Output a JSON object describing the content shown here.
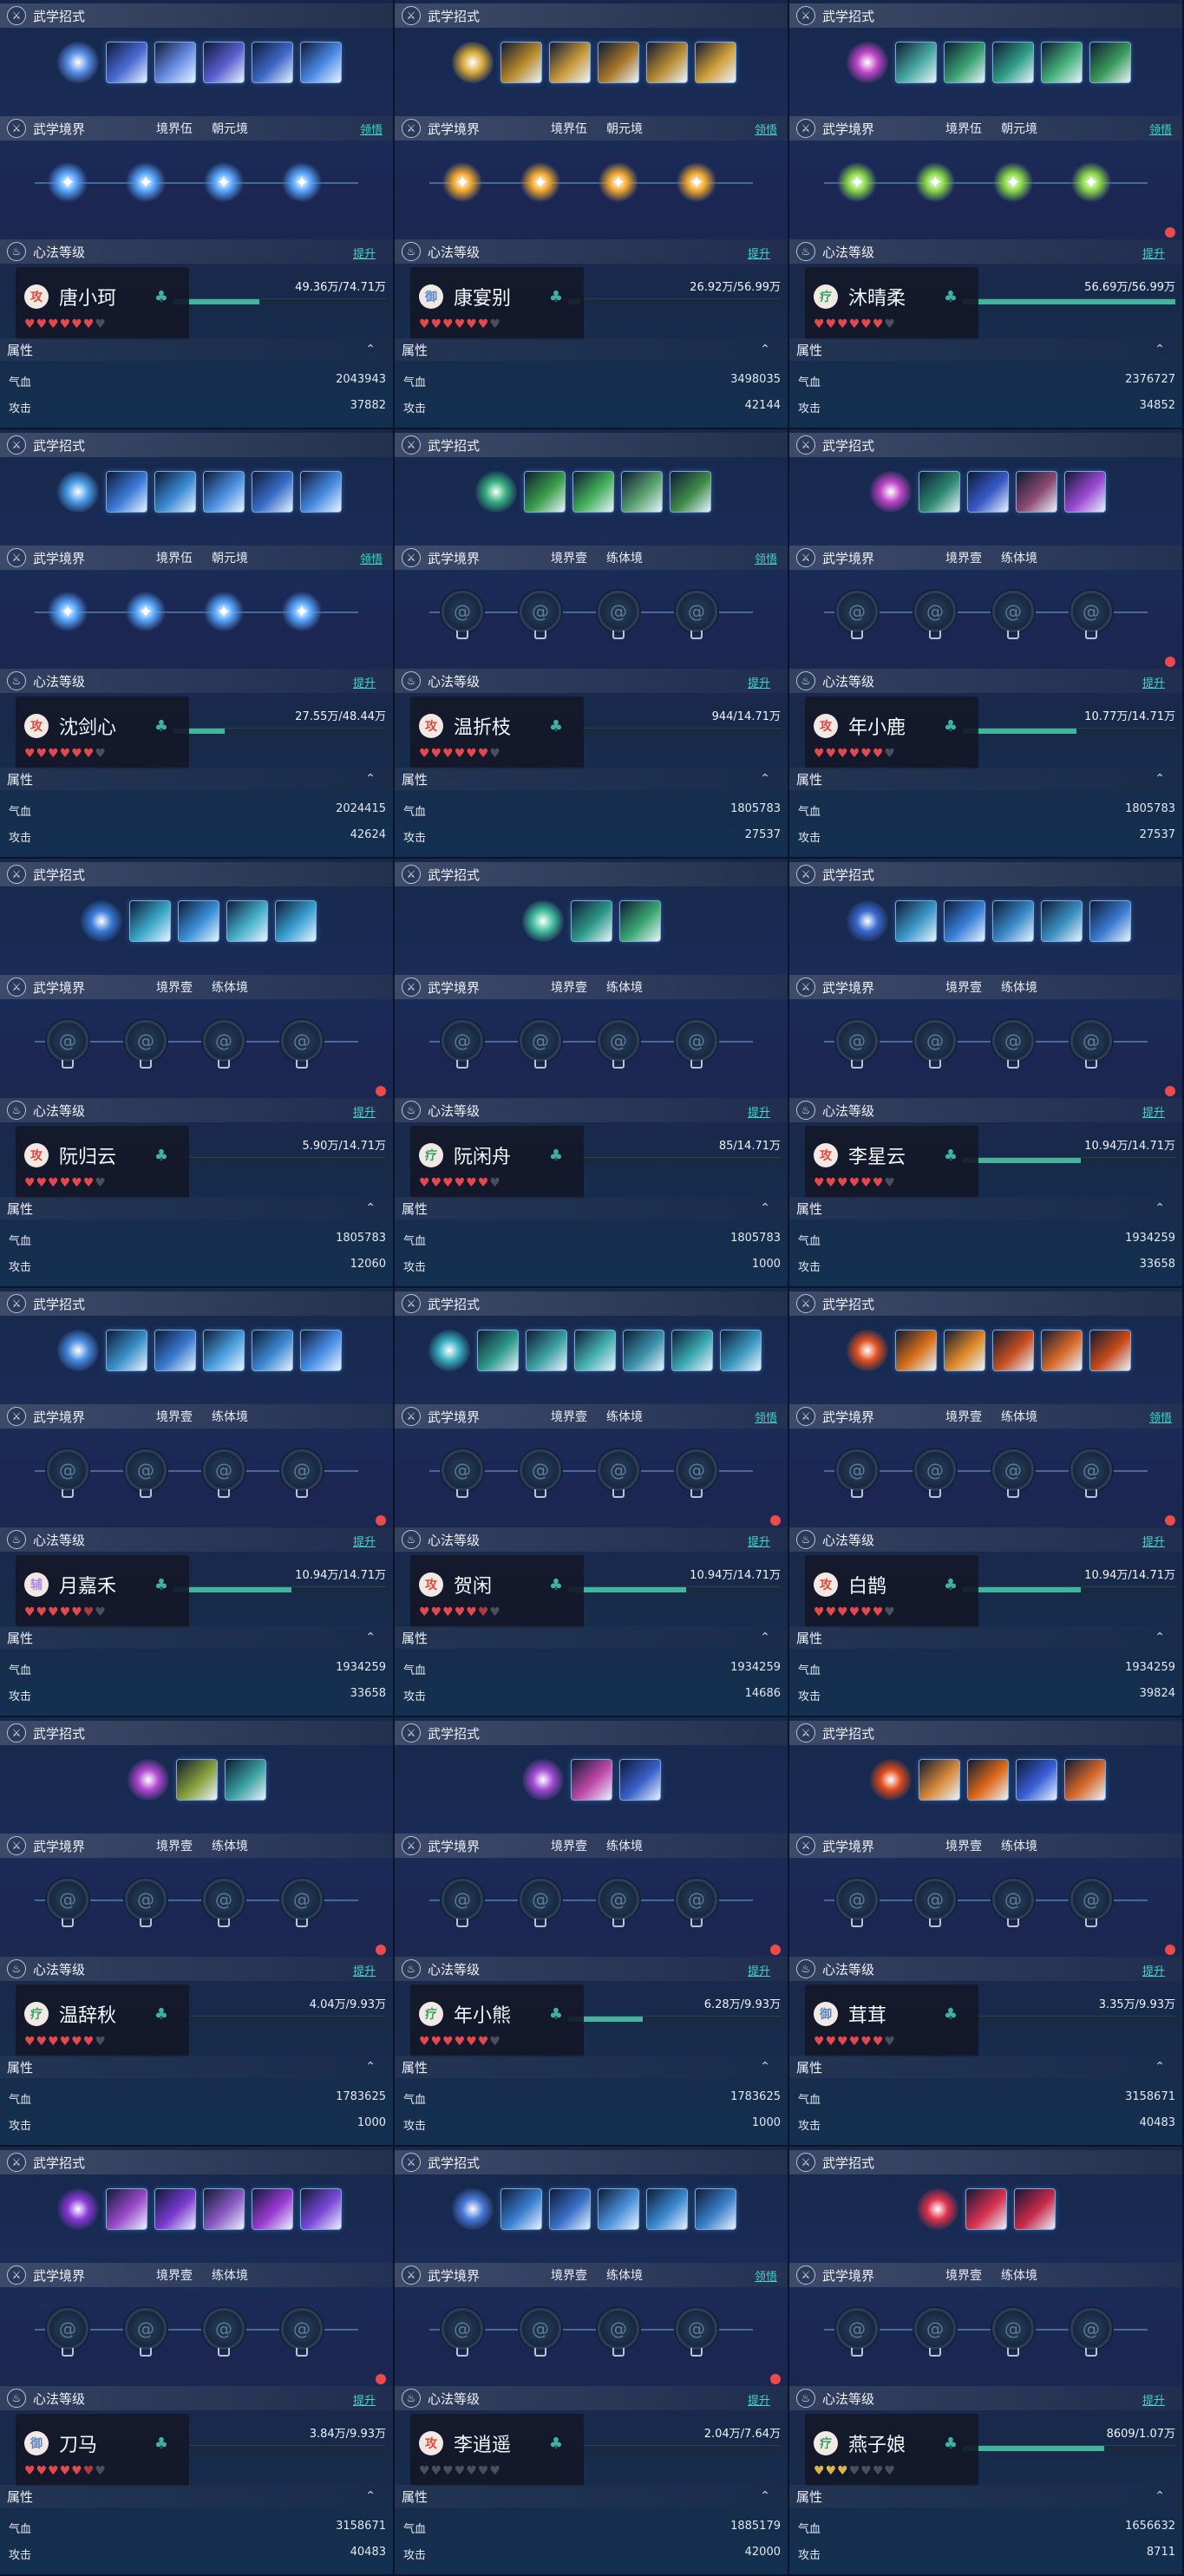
{
  "labels": {
    "skills_title": "武学招式",
    "realm_title": "武学境界",
    "heart_title": "心法等级",
    "attr_title": "属性",
    "upgrade": "提升",
    "claim": "领悟",
    "hp": "气血",
    "atk": "攻击"
  },
  "icons": {
    "section_icon": "sword-emblem-icon",
    "name_icon": "jade-toad-icon",
    "collapse_icon": "chevron-up-icon",
    "locked_node_icon": "swirl-glyph-icon"
  },
  "colors": {
    "accent": "#3fd6c8",
    "progress": "#44b49c",
    "heart_red": "#e5484d",
    "heart_gold": "#d8b64a",
    "heart_empty": "#4a4f5c",
    "notify": "#ec4b4b"
  },
  "panels": [
    {
      "name": "唐小珂",
      "badge": "攻",
      "badge_color": "#e0493e",
      "realm_tags": [
        "境界伍",
        "朝元境"
      ],
      "show_claim": true,
      "realm_active": true,
      "theme": "#4f7ff0",
      "skills": [
        "#5a8ee8",
        "#4b6bd4",
        "#6a8fe6",
        "#5b60d0",
        "#3f68c8",
        "#4b8ae6"
      ],
      "nodes": [
        "#5aa8ff",
        "#5aa8ff",
        "#5aa8ff",
        "#5aa8ff"
      ],
      "progress_text": "49.36万/74.71万",
      "progress": 0.66,
      "hearts": {
        "red": 6,
        "half": 0,
        "gold": 0,
        "empty": 1
      },
      "hp": "2043943",
      "atk": "37882",
      "notify": false
    },
    {
      "name": "康宴别",
      "badge": "御",
      "badge_color": "#5c86c8",
      "realm_tags": [
        "境界伍",
        "朝元境"
      ],
      "show_claim": true,
      "realm_active": true,
      "theme": "#c89a34",
      "skills": [
        "#d8a93a",
        "#b88a2c",
        "#c99a3c",
        "#a8782a",
        "#b88c34",
        "#d0a03a"
      ],
      "nodes": [
        "#f0a830",
        "#f0a830",
        "#f0a830",
        "#f0a830"
      ],
      "progress_text": "26.92万/56.99万",
      "progress": 0.47,
      "hearts": {
        "red": 6,
        "half": 0,
        "gold": 0,
        "empty": 1
      },
      "hp": "3498035",
      "atk": "42144",
      "notify": false
    },
    {
      "name": "沐晴柔",
      "badge": "疗",
      "badge_color": "#3da06a",
      "realm_tags": [
        "境界伍",
        "朝元境"
      ],
      "show_claim": true,
      "realm_active": true,
      "theme": "#3fae6a",
      "skills": [
        "#c046c8",
        "#48a8a0",
        "#3aa070",
        "#2f9e88",
        "#44b07a",
        "#3a9a5a"
      ],
      "nodes": [
        "#8ad84a",
        "#8ad84a",
        "#8ad84a",
        "#8ad84a"
      ],
      "progress_text": "56.69万/56.99万",
      "progress": 0.99,
      "hearts": {
        "red": 6,
        "half": 0,
        "gold": 0,
        "empty": 1
      },
      "hp": "2376727",
      "atk": "34852",
      "notify": true
    },
    {
      "name": "沈剑心",
      "badge": "攻",
      "badge_color": "#e0493e",
      "realm_tags": [
        "境界伍",
        "朝元境"
      ],
      "show_claim": true,
      "realm_active": true,
      "theme": "#3f8fe6",
      "skills": [
        "#4a9ee8",
        "#3c7ad8",
        "#3a8ad2",
        "#4a90e0",
        "#3a6ec8",
        "#468ae0"
      ],
      "nodes": [
        "#5aa8ff",
        "#5aa8ff",
        "#5aa8ff",
        "#5aa8ff"
      ],
      "progress_text": "27.55万/48.44万",
      "progress": 0.57,
      "hearts": {
        "red": 6,
        "half": 0,
        "gold": 0,
        "empty": 1
      },
      "hp": "2024415",
      "atk": "42624",
      "notify": false
    },
    {
      "name": "温折枝",
      "badge": "攻",
      "badge_color": "#e0493e",
      "realm_tags": [
        "境界壹",
        "练体境"
      ],
      "show_claim": true,
      "realm_active": false,
      "theme": "#3aa860",
      "skills": [
        "#36b080",
        "#3a9e4a",
        "#44b05a",
        "#5aa070",
        "#3f8a4a"
      ],
      "nodes": [],
      "progress_text": "944/14.71万",
      "progress": 0.01,
      "hearts": {
        "red": 6,
        "half": 0,
        "gold": 0,
        "empty": 1
      },
      "hp": "1805783",
      "atk": "27537",
      "notify": false
    },
    {
      "name": "年小鹿",
      "badge": "攻",
      "badge_color": "#e0493e",
      "realm_tags": [
        "境界壹",
        "练体境"
      ],
      "show_claim": false,
      "realm_active": false,
      "theme": "#b04ac8",
      "skills": [
        "#c046c8",
        "#2c8a70",
        "#3a5ac8",
        "#8a4a70",
        "#9a4ad0"
      ],
      "nodes": [],
      "progress_text": "10.77万/14.71万",
      "progress": 0.73,
      "hearts": {
        "red": 6,
        "half": 0,
        "gold": 0,
        "empty": 1
      },
      "hp": "1805783",
      "atk": "27537",
      "notify": true
    },
    {
      "name": "阮归云",
      "badge": "攻",
      "badge_color": "#e0493e",
      "realm_tags": [
        "境界壹",
        "练体境"
      ],
      "show_claim": false,
      "realm_active": false,
      "theme": "#3aa0d8",
      "skills": [
        "#3a7ad8",
        "#3aa8c8",
        "#3a90d8",
        "#46b0c8",
        "#3aa0d0"
      ],
      "nodes": [],
      "progress_text": "5.90万/14.71万",
      "progress": 0.4,
      "hearts": {
        "red": 6,
        "half": 0,
        "gold": 0,
        "empty": 1
      },
      "hp": "1805783",
      "atk": "12060",
      "notify": true
    },
    {
      "name": "阮闲舟",
      "badge": "疗",
      "badge_color": "#3da06a",
      "realm_tags": [
        "境界壹",
        "练体境"
      ],
      "show_claim": false,
      "realm_active": false,
      "theme": "#3ab0a0",
      "skills": [
        "#44c0a0",
        "#2e9a8a",
        "#3aa870"
      ],
      "nodes": [],
      "progress_text": "85/14.71万",
      "progress": 0.005,
      "hearts": {
        "red": 6,
        "half": 0,
        "gold": 0,
        "empty": 1
      },
      "hp": "1805783",
      "atk": "1000",
      "notify": false
    },
    {
      "name": "李星云",
      "badge": "攻",
      "badge_color": "#e0493e",
      "realm_tags": [
        "境界壹",
        "练体境"
      ],
      "show_claim": false,
      "realm_active": false,
      "theme": "#3a8ad8",
      "skills": [
        "#3a6ad0",
        "#3a98c8",
        "#3a80d8",
        "#3a8ac8",
        "#3a90c0",
        "#3a7ad0"
      ],
      "nodes": [],
      "progress_text": "10.94万/14.71万",
      "progress": 0.74,
      "hearts": {
        "red": 6,
        "half": 0,
        "gold": 0,
        "empty": 1
      },
      "hp": "1934259",
      "atk": "33658",
      "notify": true
    },
    {
      "name": "月嘉禾",
      "badge": "辅",
      "badge_color": "#b088e0",
      "realm_tags": [
        "境界壹",
        "练体境"
      ],
      "show_claim": false,
      "realm_active": false,
      "theme": "#3a8ad8",
      "skills": [
        "#4a8ae0",
        "#3a90c8",
        "#3a7ad0",
        "#4aa0e0",
        "#3a88d0",
        "#4a90e8"
      ],
      "nodes": [],
      "progress_text": "10.94万/14.71万",
      "progress": 0.74,
      "hearts": {
        "red": 5,
        "half": 1,
        "gold": 0,
        "empty": 1
      },
      "hp": "1934259",
      "atk": "33658",
      "notify": true
    },
    {
      "name": "贺闲",
      "badge": "攻",
      "badge_color": "#e0493e",
      "realm_tags": [
        "境界壹",
        "练体境"
      ],
      "show_claim": true,
      "realm_active": false,
      "theme": "#3aa8a0",
      "skills": [
        "#3ab0c0",
        "#2e9a8a",
        "#3aa0a0",
        "#44b0b0",
        "#3a90a8",
        "#3aa8b0",
        "#3a98c0"
      ],
      "nodes": [],
      "progress_text": "10.94万/14.71万",
      "progress": 0.74,
      "hearts": {
        "red": 5,
        "half": 1,
        "gold": 0,
        "empty": 1
      },
      "hp": "1934259",
      "atk": "14686",
      "notify": true
    },
    {
      "name": "白鹊",
      "badge": "攻",
      "badge_color": "#e0493e",
      "realm_tags": [
        "境界壹",
        "练体境"
      ],
      "show_claim": true,
      "realm_active": false,
      "theme": "#e0602a",
      "skills": [
        "#e05020",
        "#d8701a",
        "#e08a2a",
        "#c85020",
        "#d86a2a",
        "#c84a1a"
      ],
      "nodes": [],
      "progress_text": "10.94万/14.71万",
      "progress": 0.74,
      "hearts": {
        "red": 6,
        "half": 0,
        "gold": 0,
        "empty": 1
      },
      "hp": "1934259",
      "atk": "39824",
      "notify": true
    },
    {
      "name": "温辞秋",
      "badge": "疗",
      "badge_color": "#3da06a",
      "realm_tags": [
        "境界壹",
        "练体境"
      ],
      "show_claim": false,
      "realm_active": false,
      "theme": "#a04ad0",
      "skills": [
        "#b048d0",
        "#8aa03a",
        "#3aa0a0"
      ],
      "nodes": [],
      "progress_text": "4.04万/9.93万",
      "progress": 0.41,
      "hearts": {
        "red": 6,
        "half": 0,
        "gold": 0,
        "empty": 1
      },
      "hp": "1783625",
      "atk": "1000",
      "notify": true
    },
    {
      "name": "年小熊",
      "badge": "疗",
      "badge_color": "#3da06a",
      "realm_tags": [
        "境界壹",
        "练体境"
      ],
      "show_claim": false,
      "realm_active": false,
      "theme": "#9a4ad8",
      "skills": [
        "#a04ad0",
        "#c048a8",
        "#3a60c8"
      ],
      "nodes": [],
      "progress_text": "6.28万/9.93万",
      "progress": 0.63,
      "hearts": {
        "red": 6,
        "half": 0,
        "gold": 0,
        "empty": 1
      },
      "hp": "1783625",
      "atk": "1000",
      "notify": true
    },
    {
      "name": "茸茸",
      "badge": "御",
      "badge_color": "#5c86c8",
      "realm_tags": [
        "境界壹",
        "练体境"
      ],
      "show_claim": false,
      "realm_active": false,
      "theme": "#e06a2a",
      "skills": [
        "#e04a1a",
        "#d88a3a",
        "#e06a1a",
        "#3a60d8",
        "#d8682a"
      ],
      "nodes": [],
      "progress_text": "3.35万/9.93万",
      "progress": 0.34,
      "hearts": {
        "red": 6,
        "half": 0,
        "gold": 0,
        "empty": 1
      },
      "hp": "3158671",
      "atk": "40483",
      "notify": true
    },
    {
      "name": "刀马",
      "badge": "御",
      "badge_color": "#5c86c8",
      "realm_tags": [
        "境界壹",
        "练体境"
      ],
      "show_claim": false,
      "realm_active": false,
      "theme": "#8a4ad8",
      "skills": [
        "#8a3ad8",
        "#9a4ac8",
        "#7a3ad0",
        "#8a5ac0",
        "#9a3ad0",
        "#7a4ad8"
      ],
      "nodes": [],
      "progress_text": "3.84万/9.93万",
      "progress": 0.39,
      "hearts": {
        "red": 5,
        "half": 1,
        "gold": 0,
        "empty": 1
      },
      "hp": "3158671",
      "atk": "40483",
      "notify": true
    },
    {
      "name": "李逍遥",
      "badge": "攻",
      "badge_color": "#e0493e",
      "realm_tags": [
        "境界壹",
        "练体境"
      ],
      "show_claim": true,
      "realm_active": false,
      "theme": "#4a80d8",
      "skills": [
        "#4a7ad8",
        "#3a80d0",
        "#3a70c8",
        "#4a90d8",
        "#3a88d0",
        "#3a80c8"
      ],
      "nodes": [],
      "progress_text": "2.04万/7.64万",
      "progress": 0.27,
      "hearts": {
        "red": 0,
        "half": 0,
        "gold": 0,
        "empty": 7
      },
      "hp": "1885179",
      "atk": "42000",
      "notify": true
    },
    {
      "name": "燕子娘",
      "badge": "疗",
      "badge_color": "#3da06a",
      "realm_tags": [
        "境界壹",
        "练体境"
      ],
      "show_claim": false,
      "realm_active": false,
      "theme": "#e0304a",
      "skills": [
        "#e0304a",
        "#d83050",
        "#c82848"
      ],
      "nodes": [],
      "progress_text": "8609/1.07万",
      "progress": 0.8,
      "hearts": {
        "red": 0,
        "half": 0,
        "gold": 3,
        "empty": 4
      },
      "hp": "1656632",
      "atk": "8711",
      "notify": false
    }
  ]
}
